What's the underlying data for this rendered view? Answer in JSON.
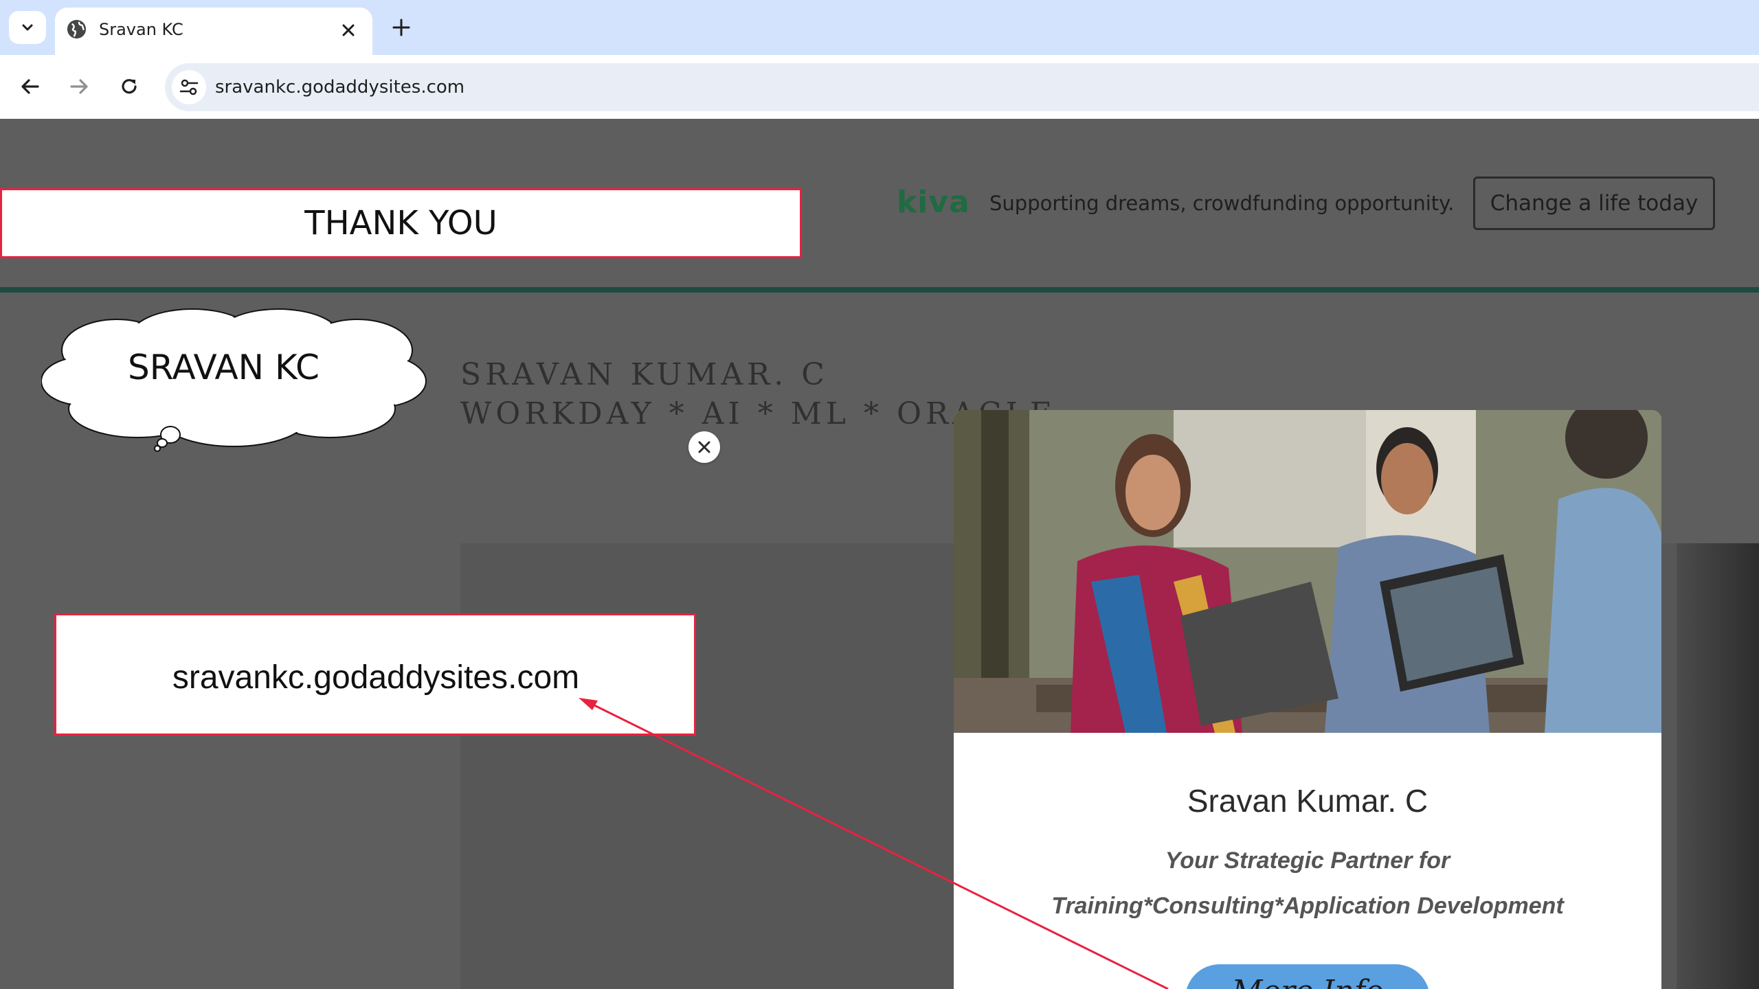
{
  "browser": {
    "tab_title": "Sravan KC",
    "url": "sravankc.godaddysites.com"
  },
  "kiva": {
    "logo": "kiva",
    "tagline": "Supporting dreams, crowdfunding opportunity.",
    "cta": "Change a life today"
  },
  "site": {
    "title_line1": "SRAVAN KUMAR. C",
    "title_line2": "WORKDAY * AI * ML * ORACLE"
  },
  "modal": {
    "name": "Sravan Kumar. C",
    "subtitle_line1": "Your Strategic Partner for",
    "subtitle_line2": "Training*Consulting*Application Development",
    "button": "More Info"
  },
  "annotations": {
    "thank_you": "THANK YOU",
    "cloud_label": "SRAVAN KC",
    "url_callout": "sravankc.godaddysites.com"
  },
  "colors": {
    "tabstrip": "#d3e3fd",
    "page_overlay": "#5e5e5e",
    "kiva_green": "#1f6b42",
    "annotation_red": "#e8223f",
    "modal_button": "#5aa0e0"
  }
}
